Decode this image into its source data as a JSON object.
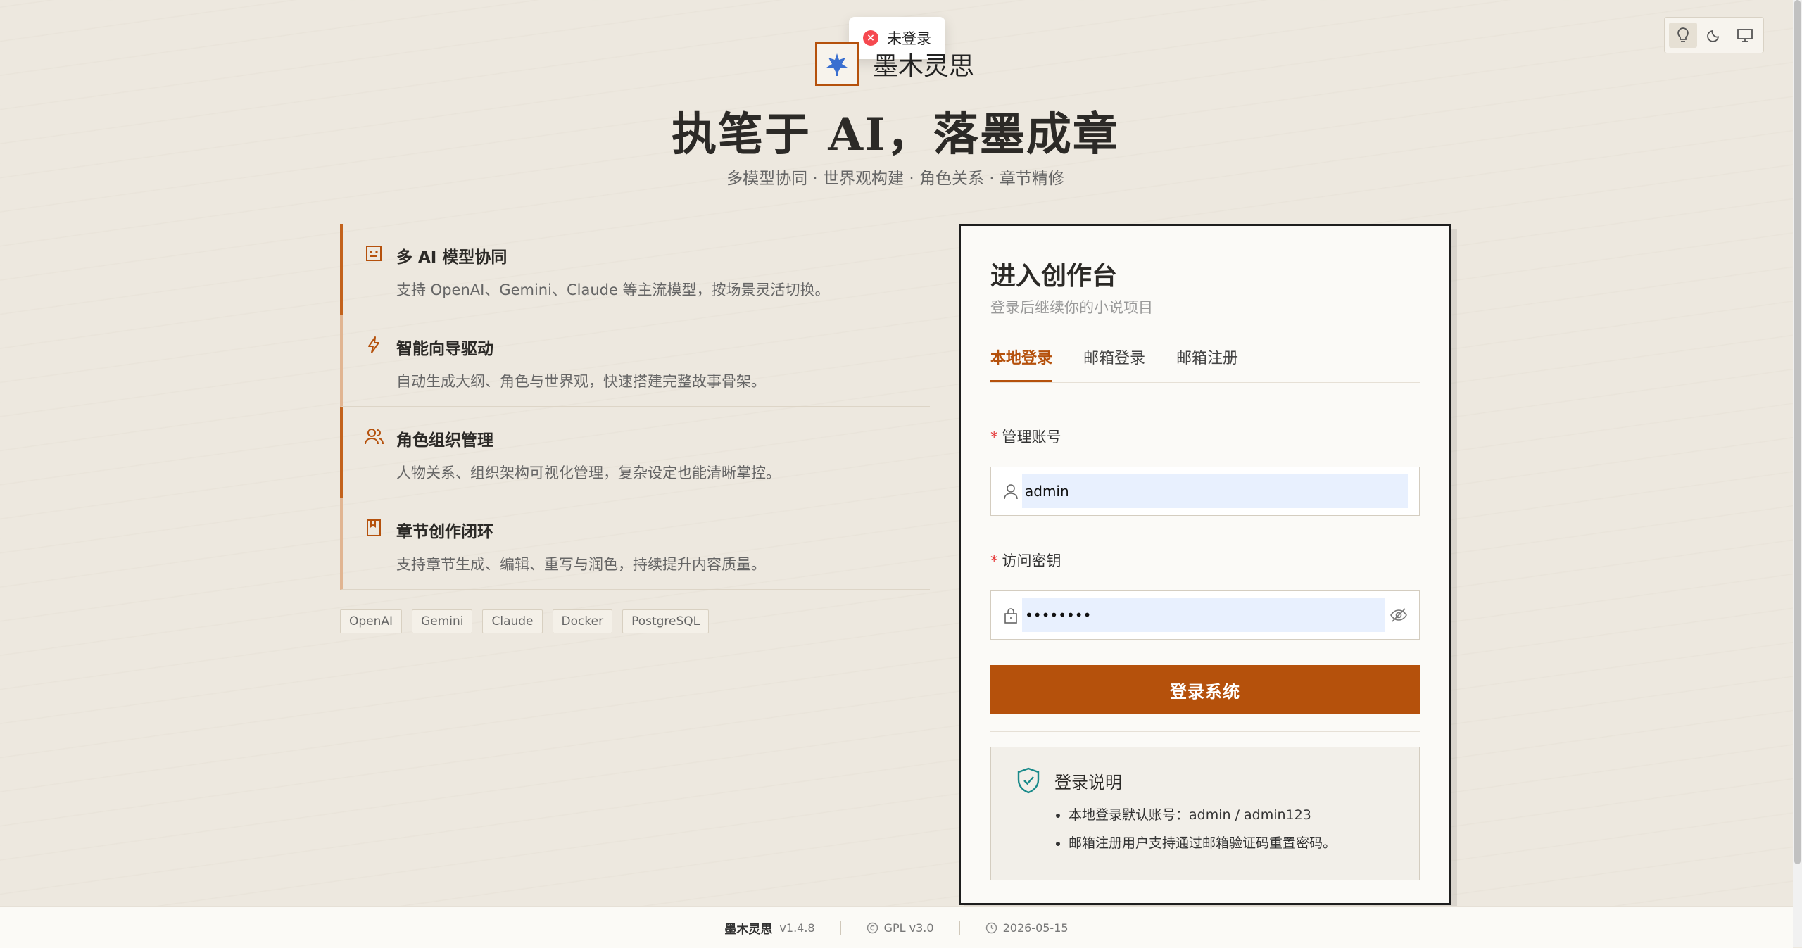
{
  "toast": {
    "text": "未登录"
  },
  "brand": {
    "name": "墨木灵思"
  },
  "hero": {
    "title": "执笔于 AI，落墨成章",
    "subtitle": "多模型协同 · 世界观构建 · 角色关系 · 章节精修"
  },
  "features": [
    {
      "title": "多 AI 模型协同",
      "desc": "支持 OpenAI、Gemini、Claude 等主流模型，按场景灵活切换。",
      "icon": "robot-icon"
    },
    {
      "title": "智能向导驱动",
      "desc": "自动生成大纲、角色与世界观，快速搭建完整故事骨架。",
      "icon": "lightning-icon"
    },
    {
      "title": "角色组织管理",
      "desc": "人物关系、组织架构可视化管理，复杂设定也能清晰掌控。",
      "icon": "users-icon"
    },
    {
      "title": "章节创作闭环",
      "desc": "支持章节生成、编辑、重写与润色，持续提升内容质量。",
      "icon": "book-icon"
    }
  ],
  "tags": [
    "OpenAI",
    "Gemini",
    "Claude",
    "Docker",
    "PostgreSQL"
  ],
  "login": {
    "title": "进入创作台",
    "subtitle": "登录后继续你的小说项目",
    "tabs": [
      "本地登录",
      "邮箱登录",
      "邮箱注册"
    ],
    "account_label": "管理账号",
    "account_value": "admin",
    "password_label": "访问密钥",
    "password_value": "••••••••",
    "submit": "登录系统",
    "notice_title": "登录说明",
    "notice_items": [
      "本地登录默认账号：admin / admin123",
      "邮箱注册用户支持通过邮箱验证码重置密码。"
    ]
  },
  "footer": {
    "name": "墨木灵思",
    "version": "v1.4.8",
    "license": "GPL v3.0",
    "date": "2026-05-15"
  },
  "colors": {
    "accent": "#b5510c",
    "error": "#f5484f",
    "shield": "#1a8a8a"
  }
}
